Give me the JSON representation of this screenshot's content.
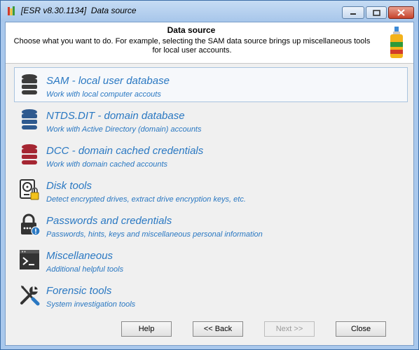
{
  "window": {
    "title": "[ESR v8.30.1134]  Data source"
  },
  "header": {
    "title": "Data source",
    "description": "Choose what you want to do. For example, selecting the SAM data source brings up miscellaneous tools for local user accounts."
  },
  "items": [
    {
      "title": "SAM - local user database",
      "subtitle": "Work with local computer accouts",
      "icon": "database-gray-icon",
      "color": "#3c3c3c",
      "selected": true
    },
    {
      "title": "NTDS.DIT - domain database",
      "subtitle": "Work with Active Directory (domain) accounts",
      "icon": "database-blue-icon",
      "color": "#2f5a8f"
    },
    {
      "title": "DCC - domain cached credentials",
      "subtitle": "Work with domain cached accounts",
      "icon": "database-red-icon",
      "color": "#a52632"
    },
    {
      "title": "Disk tools",
      "subtitle": "Detect encrypted drives, extract drive encryption keys, etc.",
      "icon": "hard-disk-lock-icon"
    },
    {
      "title": "Passwords and credentials",
      "subtitle": "Passwords, hints, keys and miscellaneous personal information",
      "icon": "password-lock-icon"
    },
    {
      "title": "Miscellaneous",
      "subtitle": "Additional helpful tools",
      "icon": "terminal-icon"
    },
    {
      "title": "Forensic tools",
      "subtitle": "System investigation tools",
      "icon": "wrench-screwdriver-icon"
    }
  ],
  "buttons": {
    "help": "Help",
    "back": "<< Back",
    "next": "Next >>",
    "close": "Close"
  },
  "colors": {
    "link_text": "#2a78c2",
    "selected_border": "#a8c3df"
  }
}
